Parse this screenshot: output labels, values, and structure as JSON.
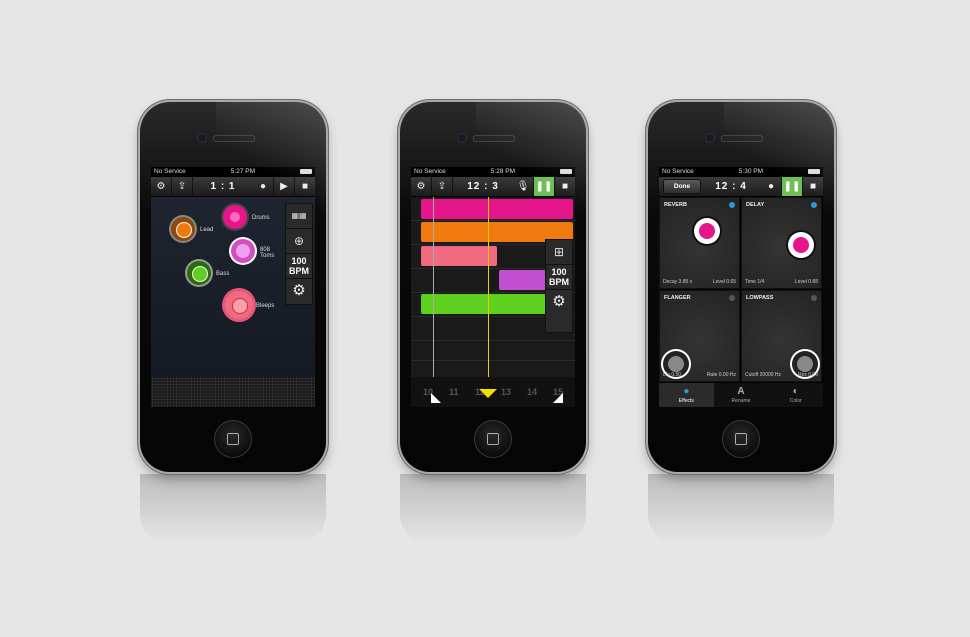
{
  "colors": {
    "pink": "#e4168a",
    "orange": "#f07a10",
    "salmon": "#f06a80",
    "violet": "#c050d0",
    "green": "#5fd020",
    "accent": "#6fbf55",
    "blue": "#2a9ad8"
  },
  "phone1": {
    "status": {
      "carrier": "No Service",
      "time": "5:27 PM"
    },
    "toolbar": {
      "settings_icon": "settings-icon",
      "share_icon": "share-icon",
      "counter": "1 : 1",
      "record": "●",
      "play": "▶",
      "stop": "■"
    },
    "bubbles": [
      {
        "label": "Lead",
        "color": "#f07a10"
      },
      {
        "label": "Drums",
        "color": "#e4168a"
      },
      {
        "label": "808\nToms",
        "color": "#d050c0"
      },
      {
        "label": "Bass",
        "color": "#5fd020"
      },
      {
        "label": "Bleeps",
        "color": "#f06a80"
      }
    ],
    "side": {
      "bpm": "100\nBPM"
    }
  },
  "phone2": {
    "status": {
      "carrier": "No Service",
      "time": "5:28 PM"
    },
    "toolbar": {
      "counter": "12 : 3",
      "pause": "❚❚",
      "stop": "■"
    },
    "ruler": [
      "10",
      "11",
      "12",
      "13",
      "14",
      "15"
    ],
    "side": {
      "bpm": "100\nBPM"
    }
  },
  "phone3": {
    "status": {
      "carrier": "No Service",
      "time": "5:30 PM"
    },
    "toolbar": {
      "done": "Done",
      "counter": "12 : 4",
      "pause": "❚❚",
      "stop": "■"
    },
    "effects": [
      {
        "title": "REVERB",
        "left": "Decay 3.85 s",
        "right": "Level 0.65"
      },
      {
        "title": "DELAY",
        "left": "Time 1/4",
        "right": "Level 0.88"
      },
      {
        "title": "FLANGER",
        "left": "Lfo 0.00",
        "right": "Rate 0.00 Hz"
      },
      {
        "title": "LOWPASS",
        "left": "Cutoff 20000 Hz",
        "right": "Res 0.00"
      }
    ],
    "tabs": [
      {
        "label": "Effects",
        "icon": "●"
      },
      {
        "label": "Rename",
        "icon": "A"
      },
      {
        "label": "Color",
        "icon": "◐"
      }
    ]
  }
}
